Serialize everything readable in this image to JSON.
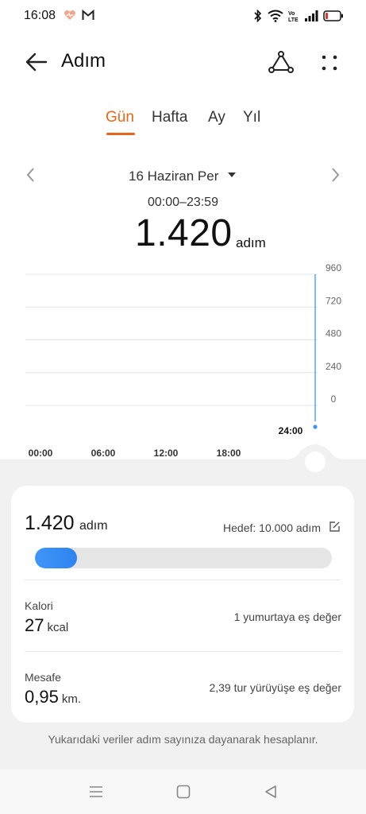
{
  "status": {
    "time": "16:08",
    "battery_color": "#e0332d"
  },
  "header": {
    "title": "Adım"
  },
  "tabs": [
    {
      "label": "Gün",
      "active": true
    },
    {
      "label": "Hafta",
      "active": false
    },
    {
      "label": "Ay",
      "active": false
    },
    {
      "label": "Yıl",
      "active": false
    }
  ],
  "date": {
    "label": "16 Haziran Per",
    "range": "00:00–23:59"
  },
  "summary": {
    "steps": "1.420",
    "unit": "adım"
  },
  "chart_data": {
    "type": "bar",
    "x_tick_labels": [
      "00:00",
      "06:00",
      "12:00",
      "18:00"
    ],
    "y_tick_labels": [
      "960",
      "720",
      "480",
      "240",
      "0"
    ],
    "ylim": [
      0,
      960
    ],
    "cursor_label": "24:00",
    "bars": [
      {
        "x": "24:00",
        "value": 960
      }
    ],
    "grid": true,
    "accent_color": "#3f96f8"
  },
  "card": {
    "steps": "1.420",
    "steps_unit": "adım",
    "goal": "Hedef: 10.000 adım",
    "progress": 0.142,
    "calories": {
      "label": "Kalori",
      "value": "27",
      "unit": "kcal",
      "equivalent": "1 yumurtaya eş değer"
    },
    "distance": {
      "label": "Mesafe",
      "value": "0,95",
      "unit": "km.",
      "equivalent": "2,39 tur yürüyüşe eş değer"
    }
  },
  "footnote": "Yukarıdaki veriler adım sayınıza dayanarak hesaplanır.",
  "colors": {
    "accent": "#e8661b",
    "progress": "#3f96f8"
  }
}
